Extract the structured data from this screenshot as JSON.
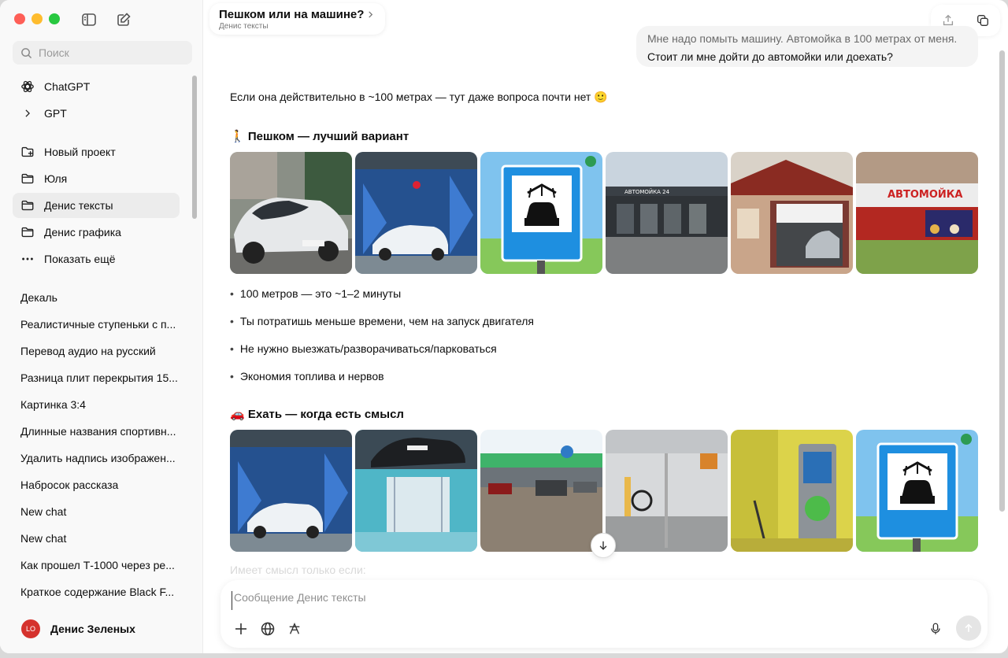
{
  "sidebar": {
    "search_placeholder": "Поиск",
    "top_items": [
      {
        "label": "ChatGPT"
      },
      {
        "label": "GPT"
      }
    ],
    "projects": [
      {
        "label": "Новый проект"
      },
      {
        "label": "Юля"
      },
      {
        "label": "Денис тексты"
      },
      {
        "label": "Денис графика"
      },
      {
        "label": "Показать ещё"
      }
    ],
    "chats": [
      "Декаль",
      "Реалистичные ступеньки с п...",
      "Перевод аудио на русский",
      "Разница плит перекрытия 15...",
      "Картинка 3:4",
      "Длинные названия спортивн...",
      "Удалить надпись изображен...",
      "Набросок рассказа",
      "New chat",
      "New chat",
      "Как прошел Т-1000 через ре...",
      "Краткое содержание Black F..."
    ],
    "user": {
      "initials": "LO",
      "name": "Денис Зеленых"
    }
  },
  "header": {
    "title": "Пешком или на машине?",
    "subtitle": "Денис тексты"
  },
  "user_message": {
    "line1": "Мне надо помыть машину. Автомойка в 100 метрах от меня.",
    "line2": "Стоит ли мне дойти до автомойки или доехать?"
  },
  "answer": {
    "intro": "Если она действительно в ~100 метрах — тут даже вопроса почти нет 🙂",
    "section1_title": "🚶 Пешком — лучший вариант",
    "bullets": [
      "100 метров — это ~1–2 минуты",
      "Ты потратишь меньше времени, чем на запуск двигателя",
      "Не нужно выезжать/разворачиваться/парковаться",
      "Экономия топлива и нервов"
    ],
    "section2_title": "🚗 Ехать — когда есть смысл",
    "faded_text": "Имеет смысл только если:"
  },
  "images": {
    "sign_text": "АВТОМОЙКА",
    "building_sign": "АВТОМОЙКА 24"
  },
  "composer": {
    "placeholder": "Сообщение Денис тексты"
  },
  "colors": {
    "accent_red": "#d5322d",
    "sign_blue": "#1e8fe0"
  }
}
